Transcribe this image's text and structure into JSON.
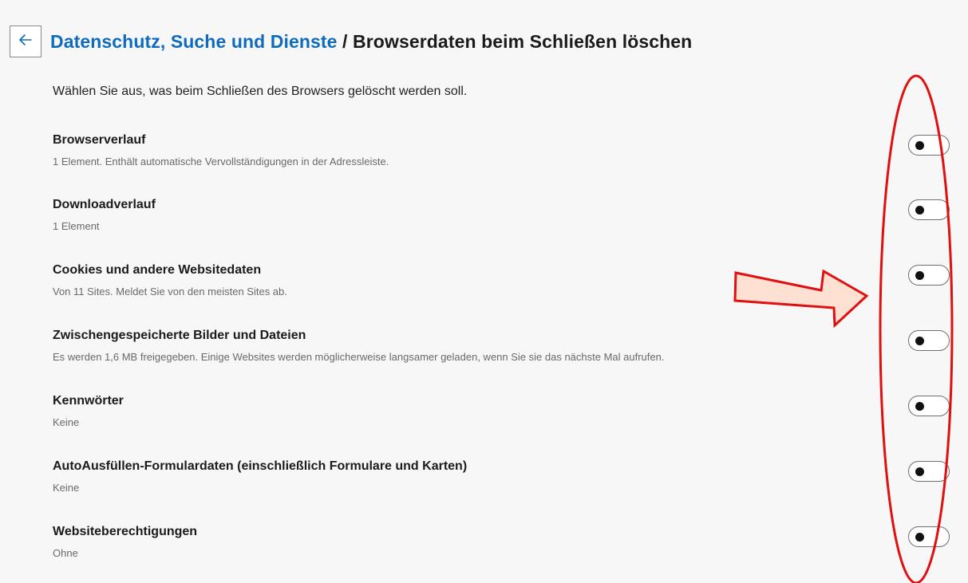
{
  "header": {
    "back_icon": "arrow-left-icon",
    "breadcrumb_parent": "Datenschutz, Suche und Dienste",
    "breadcrumb_separator": " / ",
    "breadcrumb_current": "Browserdaten beim Schließen löschen"
  },
  "intro": "Wählen Sie aus, was beim Schließen des Browsers gelöscht werden soll.",
  "items": [
    {
      "title": "Browserverlauf",
      "description": "1 Element. Enthält automatische Vervollständigungen in der Adressleiste.",
      "enabled": false
    },
    {
      "title": "Downloadverlauf",
      "description": "1 Element",
      "enabled": false
    },
    {
      "title": "Cookies und andere Websitedaten",
      "description": "Von 11 Sites. Meldet Sie von den meisten Sites ab.",
      "enabled": false
    },
    {
      "title": "Zwischengespeicherte Bilder und Dateien",
      "description": "Es werden 1,6 MB freigegeben. Einige Websites werden möglicherweise langsamer geladen, wenn Sie sie das nächste Mal aufrufen.",
      "enabled": false
    },
    {
      "title": "Kennwörter",
      "description": "Keine",
      "enabled": false
    },
    {
      "title": "AutoAusfüllen-Formulardaten (einschließlich Formulare und Karten)",
      "description": "Keine",
      "enabled": false
    },
    {
      "title": "Websiteberechtigungen",
      "description": "Ohne",
      "enabled": false
    }
  ],
  "colors": {
    "link": "#0f6cbd",
    "annotation_red": "#e01010",
    "arrow_fill": "#fde0d2"
  }
}
